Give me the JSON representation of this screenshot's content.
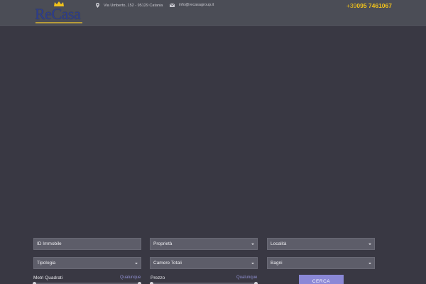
{
  "header": {
    "logo_text": "ReCasa",
    "address": "Via Umberto, 152 - 95129 Catania",
    "email": "info@recasagroup.it",
    "phone_prefix": "+39",
    "phone_number": "095 7461067",
    "colors": {
      "topbar": "#4b4d56",
      "phone": "#f1c21b",
      "logo": "#2c3d8f"
    }
  },
  "search_form": {
    "id_field_placeholder": "ID Immobile",
    "selects": {
      "proprieta": "Proprietà",
      "localita": "Località",
      "tipologia": "Tipologia",
      "camere": "Camere Totali",
      "bagni": "Bagni"
    },
    "ranges": {
      "metri": {
        "label": "Metri Quadrati",
        "value": "Qualunque"
      },
      "prezzo": {
        "label": "Prezzo",
        "value": "Qualunque"
      }
    },
    "submit_label": "CERCA",
    "accent_color": "#8a88d6"
  }
}
